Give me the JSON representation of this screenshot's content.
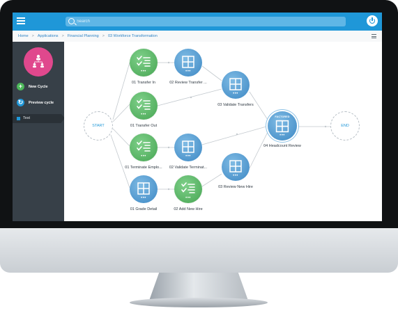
{
  "topbar": {
    "search_placeholder": "Search"
  },
  "breadcrumb": {
    "items": [
      "Home",
      "Applications",
      "Financial Planning",
      "03 Workforce Transformation"
    ]
  },
  "sidebar": {
    "new_cycle_label": "New Cycle",
    "preview_cycle_label": "Preview cycle",
    "test_label": "Test"
  },
  "workflow": {
    "start_label": "START",
    "end_label": "END",
    "node_menu": "•••",
    "nodes": [
      {
        "label": "01 Transfer In",
        "kind": "task"
      },
      {
        "label": "02 Review Transfer ...",
        "kind": "grid"
      },
      {
        "label": "03 Validate Transfers",
        "kind": "grid"
      },
      {
        "label": "01 Transfer Out",
        "kind": "task"
      },
      {
        "label": "01 Terminate Emplo...",
        "kind": "task"
      },
      {
        "label": "02 Validate Terminat...",
        "kind": "grid"
      },
      {
        "label": "04 Headcount Review",
        "kind": "grid",
        "badge": "FACTORED"
      },
      {
        "label": "03 Review New Hire",
        "kind": "grid"
      },
      {
        "label": "01 Grade Detail",
        "kind": "grid"
      },
      {
        "label": "02 Add New Hire",
        "kind": "task"
      }
    ]
  },
  "colors": {
    "accent": "#1f97d8",
    "sidebar": "#374048",
    "task_node": "#55b560",
    "grid_node": "#4c94cf",
    "avatar": "#e0488d"
  }
}
